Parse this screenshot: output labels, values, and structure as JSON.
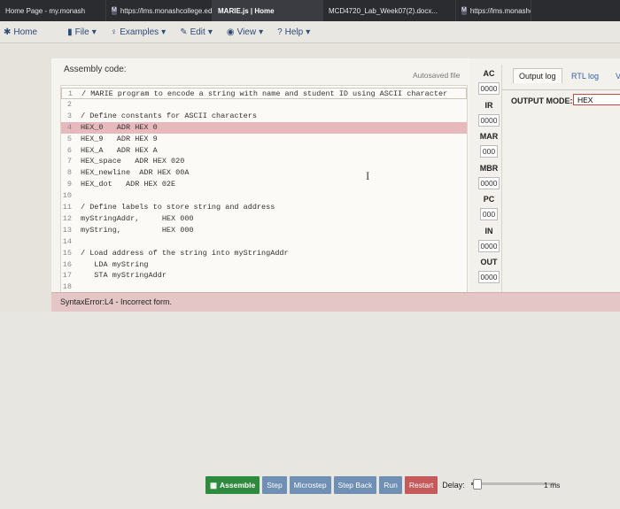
{
  "tabs": [
    {
      "label": "Home Page - my.monash",
      "w": 120
    },
    {
      "label": "https://lms.monashcollege.edu.a...",
      "w": 120,
      "fav": "M"
    },
    {
      "label": "MARIE.js | Home",
      "w": 125,
      "active": true
    },
    {
      "label": "MCD4720_Lab_Week07(2).docx...",
      "w": 150
    },
    {
      "label": "https://lms.monashcolle",
      "w": 85,
      "fav": "M"
    }
  ],
  "menu": {
    "home": "Home",
    "file": "File",
    "examples": "Examples",
    "edit": "Edit",
    "view": "View",
    "help": "Help"
  },
  "editor": {
    "label": "Assembly code:",
    "autosave": "Autosaved file",
    "cursor_glyph": "I",
    "lines": [
      {
        "n": "1",
        "t": "/ MARIE program to encode a string with name and student ID using ASCII character"
      },
      {
        "n": "2",
        "t": ""
      },
      {
        "n": "3",
        "t": "/ Define constants for ASCII characters"
      },
      {
        "n": "4",
        "t": "HEX_0   ADR HEX 0",
        "err": true
      },
      {
        "n": "5",
        "t": "HEX_9   ADR HEX 9"
      },
      {
        "n": "6",
        "t": "HEX_A   ADR HEX A"
      },
      {
        "n": "7",
        "t": "HEX_space   ADR HEX 020"
      },
      {
        "n": "8",
        "t": "HEX_newline  ADR HEX 00A"
      },
      {
        "n": "9",
        "t": "HEX_dot   ADR HEX 02E"
      },
      {
        "n": "10",
        "t": ""
      },
      {
        "n": "11",
        "t": "/ Define labels to store string and address"
      },
      {
        "n": "12",
        "t": "myStringAddr,     HEX 000"
      },
      {
        "n": "13",
        "t": "myString,         HEX 000"
      },
      {
        "n": "14",
        "t": ""
      },
      {
        "n": "15",
        "t": "/ Load address of the string into myStringAddr"
      },
      {
        "n": "16",
        "t": "   LDA myString"
      },
      {
        "n": "17",
        "t": "   STA myStringAddr"
      },
      {
        "n": "18",
        "t": ""
      }
    ]
  },
  "error": "SyntaxError:L4 - Incorrect form.",
  "registers": [
    {
      "name": "AC",
      "value": "0000"
    },
    {
      "name": "IR",
      "value": "0000"
    },
    {
      "name": "MAR",
      "value": "000"
    },
    {
      "name": "MBR",
      "value": "0000"
    },
    {
      "name": "PC",
      "value": "000"
    },
    {
      "name": "IN",
      "value": "0000"
    },
    {
      "name": "OUT",
      "value": "0000"
    }
  ],
  "right": {
    "tab_output": "Output log",
    "tab_rtl": "RTL log",
    "tab_more": "V",
    "mode_label": "OUTPUT MODE:",
    "mode_value": "HEX"
  },
  "controls": {
    "assemble": "Assemble",
    "step": "Step",
    "microstep": "Microstep",
    "stepback": "Step Back",
    "run": "Run",
    "restart": "Restart",
    "delay": "Delay:",
    "ms": "1 ms",
    "delay_fraction": 0.05
  }
}
